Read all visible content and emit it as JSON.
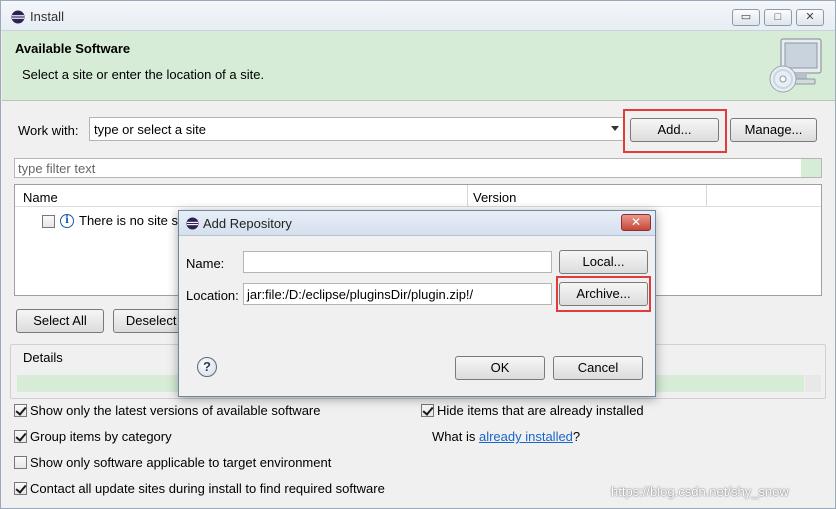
{
  "window": {
    "title": "Install",
    "controls": {
      "minimize": "▭",
      "maximize": "□",
      "close": "✕"
    }
  },
  "banner": {
    "heading": "Available Software",
    "subtitle": "Select a site or enter the location of a site."
  },
  "work_with": {
    "label": "Work with:",
    "value": "type or select a site",
    "add_label": "Add...",
    "manage_label": "Manage..."
  },
  "filter": {
    "placeholder": "type filter text"
  },
  "table": {
    "columns": [
      "Name",
      "Version"
    ],
    "rows": [
      {
        "text": "There is no site s",
        "checked": false
      }
    ]
  },
  "buttons": {
    "select_all": "Select All",
    "deselect_all": "Deselect A"
  },
  "details": {
    "label": "Details"
  },
  "options": [
    {
      "label": "Show only the latest versions of available software",
      "checked": true
    },
    {
      "label": "Group items by category",
      "checked": true
    },
    {
      "label": "Show only software applicable to target environment",
      "checked": false
    },
    {
      "label": "Contact all update sites during install to find required software",
      "checked": true
    },
    {
      "label": "Hide items that are already installed",
      "checked": true
    }
  ],
  "installed": {
    "prefix": "What is ",
    "link": "already installed",
    "suffix": "?"
  },
  "watermark": "https://blog.csdn.net/shy_snow",
  "dialog": {
    "title": "Add Repository",
    "name_label": "Name:",
    "name_value": "",
    "location_label": "Location:",
    "location_value": "jar:file:/D:/eclipse/pluginsDir/plugin.zip!/",
    "local_label": "Local...",
    "archive_label": "Archive...",
    "ok_label": "OK",
    "cancel_label": "Cancel",
    "help_symbol": "?",
    "close_symbol": "✕"
  },
  "colors": {
    "banner_bg": "#d6ecd6",
    "highlight": "#e23b3b",
    "link": "#1a66c8"
  }
}
